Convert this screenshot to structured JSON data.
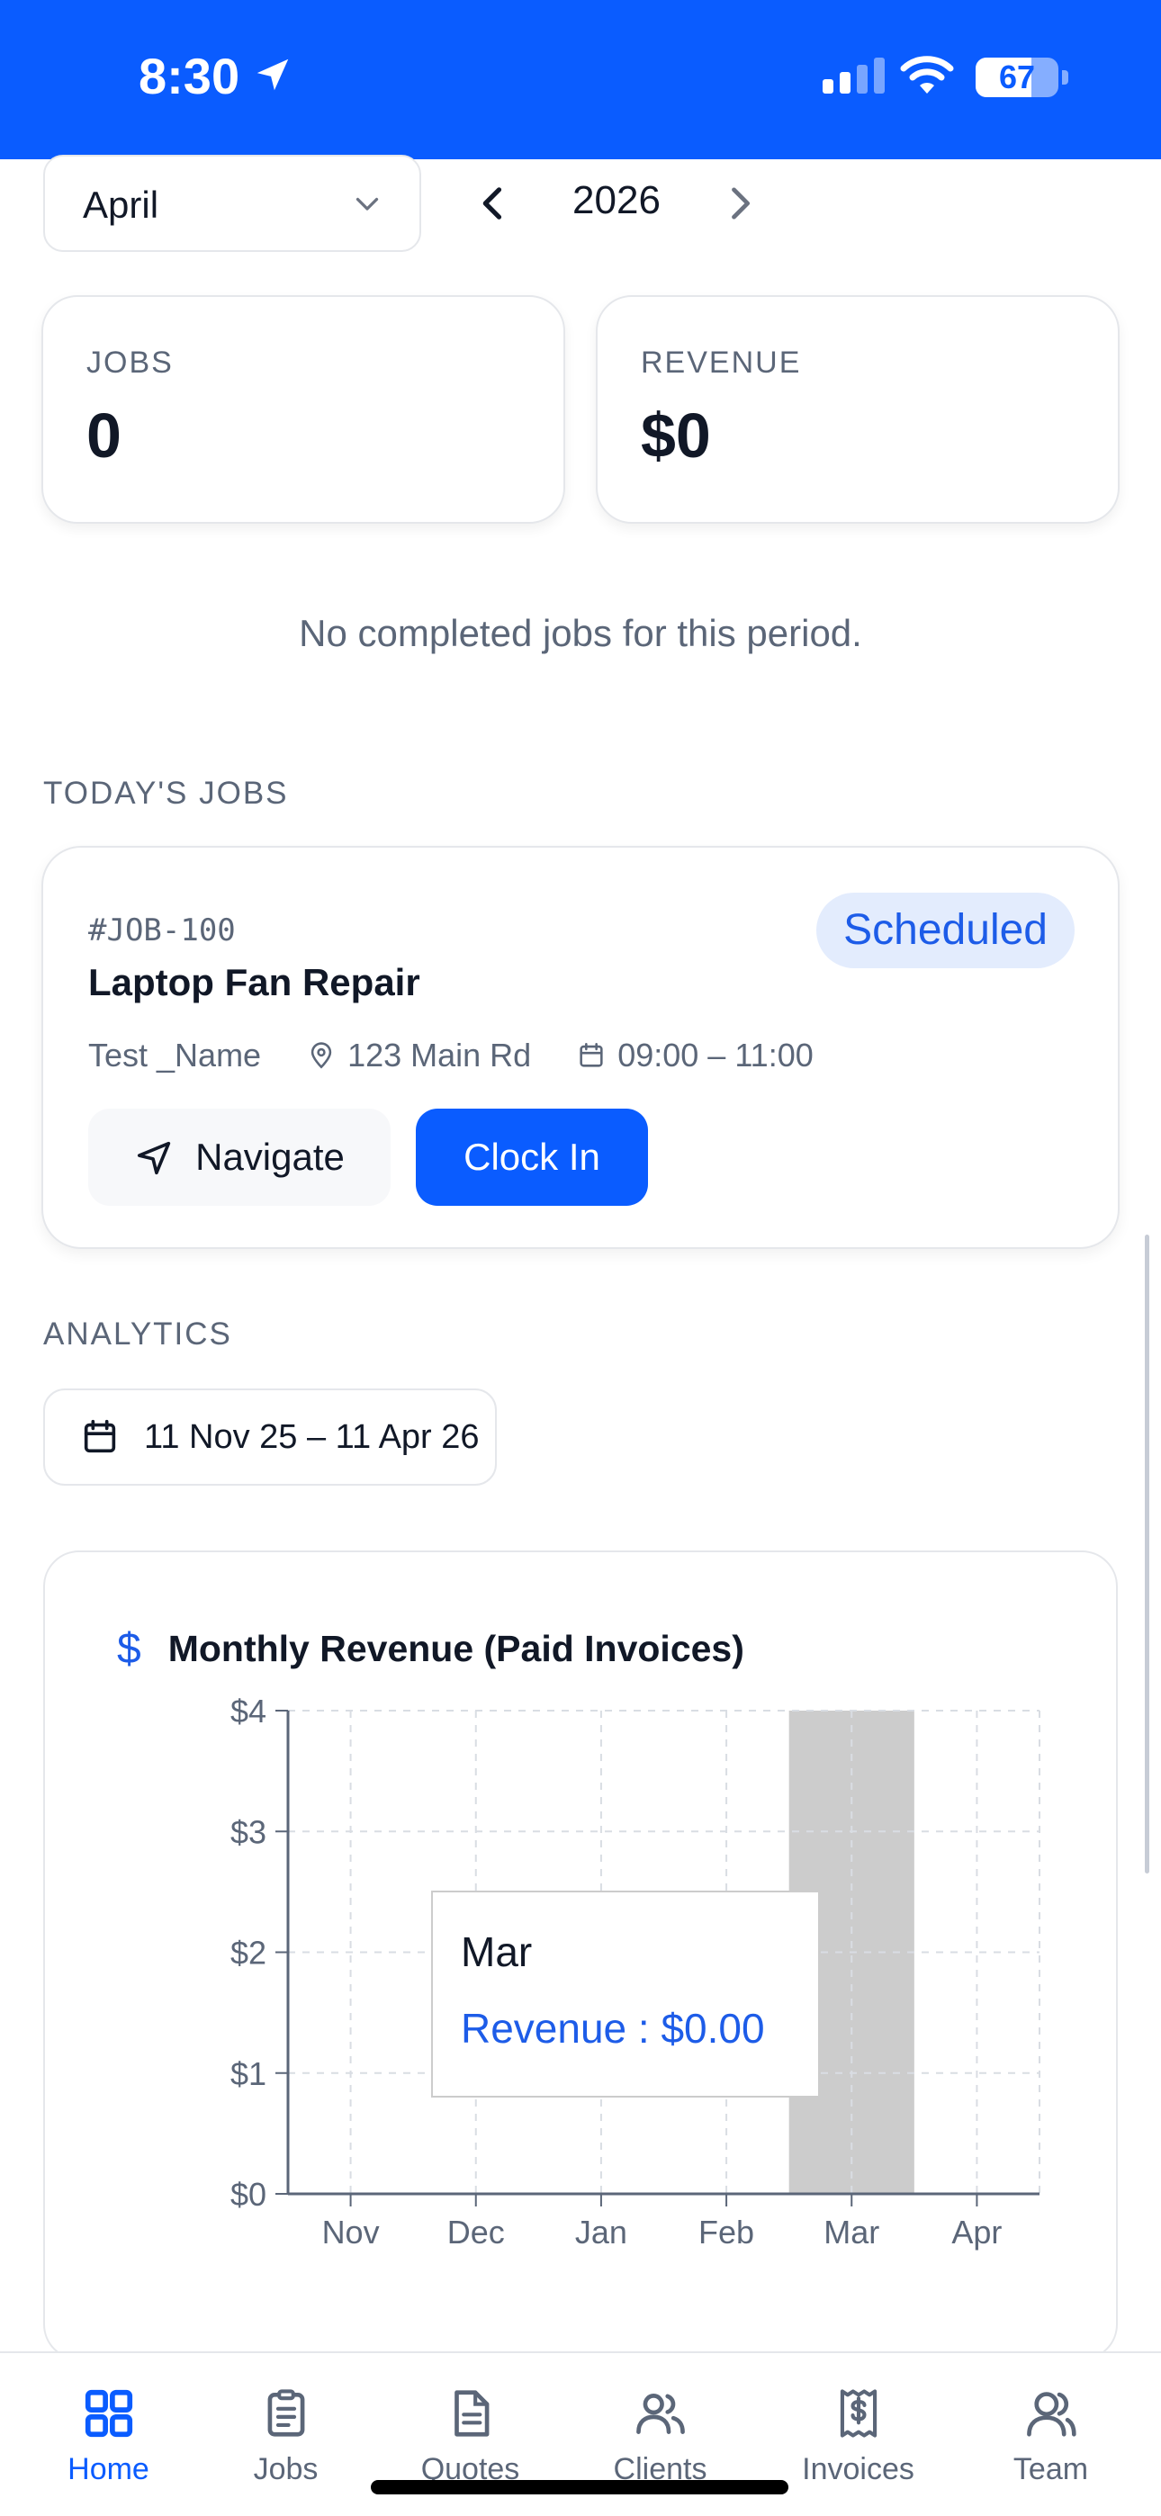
{
  "status_bar": {
    "time": "8:30",
    "battery": "67",
    "battery_level": 0.67
  },
  "period": {
    "month": "April",
    "year": "2026"
  },
  "stats": [
    {
      "title": "JOBS",
      "value": "0"
    },
    {
      "title": "REVENUE",
      "value": "$0"
    }
  ],
  "empty_message": "No completed jobs for this period.",
  "todays_jobs": {
    "section_title": "TODAY'S JOBS",
    "job": {
      "id": "#JOB-100",
      "title": "Laptop Fan Repair",
      "status": "Scheduled",
      "client": "Test _Name",
      "address": "123 Main Rd",
      "time": "09:00 – 11:00",
      "navigate_label": "Navigate",
      "clock_in_label": "Clock In"
    }
  },
  "analytics": {
    "section_title": "ANALYTICS",
    "date_range": "11 Nov 25 – 11 Apr 26"
  },
  "chart_data": {
    "type": "bar",
    "title": "Monthly Revenue (Paid Invoices)",
    "categories": [
      "Nov",
      "Dec",
      "Jan",
      "Feb",
      "Mar",
      "Apr"
    ],
    "values": [
      0,
      0,
      0,
      0,
      0,
      0
    ],
    "y_ticks": [
      "$0",
      "$1",
      "$2",
      "$3",
      "$4"
    ],
    "ylim": [
      0,
      4
    ],
    "grid": true,
    "highlighted_category": "Mar",
    "tooltip": {
      "label": "Mar",
      "value_text": "Revenue : $0.00"
    },
    "colors": {
      "highlight": "#cccccc",
      "axis": "#5b6678",
      "grid": "#d9dde3",
      "tooltip_value": "#1d5ce8"
    }
  },
  "bottom_nav": [
    {
      "label": "Home",
      "icon": "grid-icon",
      "active": true
    },
    {
      "label": "Jobs",
      "icon": "clipboard-icon",
      "active": false
    },
    {
      "label": "Quotes",
      "icon": "document-icon",
      "active": false
    },
    {
      "label": "Clients",
      "icon": "users-icon",
      "active": false
    },
    {
      "label": "Invoices",
      "icon": "receipt-icon",
      "active": false
    },
    {
      "label": "Team",
      "icon": "team-icon",
      "active": false
    }
  ],
  "colors": {
    "primary": "#0a5cff",
    "badge_bg": "#e3ecfd",
    "muted": "#5b6678"
  }
}
